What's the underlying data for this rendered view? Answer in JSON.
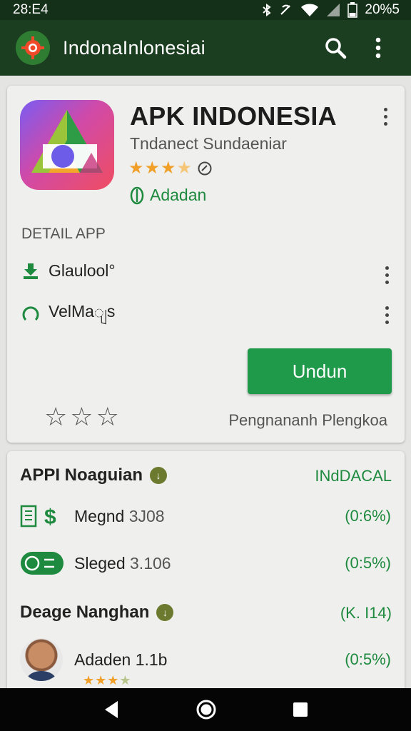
{
  "status_bar": {
    "time": "28:E4",
    "battery": "20%5"
  },
  "app_bar": {
    "title": "IndonaInlonesiai",
    "search_icon": "search-icon",
    "menu_icon": "more-vert-icon"
  },
  "app_card": {
    "title": "APK INDONESIA",
    "developer": "Tndanect Sundaeniar",
    "rating_stars": 3.5,
    "install_status": "Adadan",
    "detail_label": "DETAIL APP",
    "detail_rows": [
      {
        "label": "Glaulool°",
        "icon": "download-icon"
      },
      {
        "label": "VelMaျs",
        "icon": "circle-arc-icon"
      }
    ],
    "install_button": "Undun",
    "review_link": "Pengnananh Plengkoa"
  },
  "list_card": {
    "section1": {
      "title": "APPI Noaguian",
      "right": "INdDACAL"
    },
    "rows1": [
      {
        "label": "Megnd",
        "number": "3J08",
        "value": "(0:6%)"
      },
      {
        "label": "Sleged",
        "number": "3.106",
        "value": "(0:5%)"
      }
    ],
    "section2": {
      "title": "Deage Nanghan",
      "right": "(K. I14)"
    },
    "rows2": [
      {
        "label": "Adaden 1.1b",
        "value": "(0:5%)"
      }
    ]
  },
  "colors": {
    "app_bar": "#1b3d20",
    "accent_green": "#1f9a4a",
    "star_orange": "#f0a028"
  }
}
